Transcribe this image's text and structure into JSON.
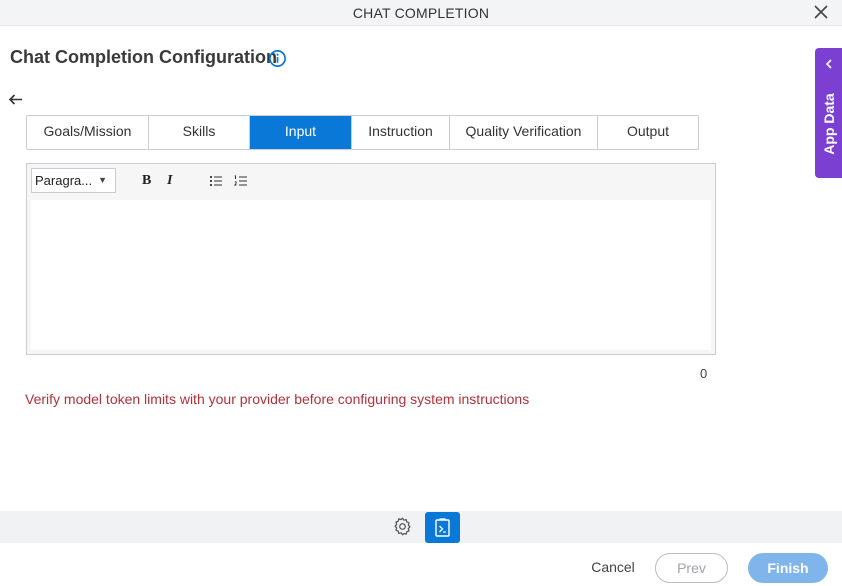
{
  "window": {
    "title": "CHAT COMPLETION"
  },
  "page": {
    "title": "Chat Completion Configuration"
  },
  "side_panel": {
    "label": "App Data"
  },
  "tabs": [
    {
      "label": "Goals/Mission",
      "active": false
    },
    {
      "label": "Skills",
      "active": false
    },
    {
      "label": "Input",
      "active": true
    },
    {
      "label": "Instruction",
      "active": false
    },
    {
      "label": "Quality Verification",
      "active": false
    },
    {
      "label": "Output",
      "active": false
    }
  ],
  "editor": {
    "format_select": "Paragra...",
    "bold_label": "B",
    "italic_label": "I",
    "content": "",
    "char_count": "0"
  },
  "warning_text": "Verify model token limits with your provider before configuring system instructions",
  "footer": {
    "cancel_label": "Cancel",
    "prev_label": "Prev",
    "finish_label": "Finish"
  },
  "colors": {
    "accent": "#0a78d6",
    "app_data_panel": "#7b3fd1",
    "warning": "#b0323a",
    "finish_button": "#7fb5ea"
  },
  "icons": [
    "close-icon",
    "info-icon",
    "back-arrow-icon",
    "chevron-left-icon",
    "bullet-list-icon",
    "numbered-list-icon",
    "gear-icon",
    "document-icon"
  ]
}
